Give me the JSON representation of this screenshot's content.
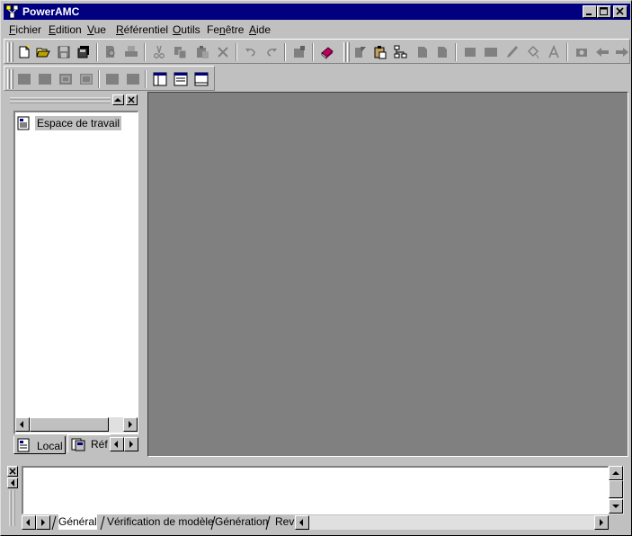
{
  "window": {
    "title": "PowerAMC"
  },
  "menubar": {
    "items": [
      {
        "label_pre": "",
        "label_u": "F",
        "label_post": "ichier"
      },
      {
        "label_pre": "",
        "label_u": "E",
        "label_post": "dition"
      },
      {
        "label_pre": "",
        "label_u": "V",
        "label_post": "ue"
      },
      {
        "label_pre": "",
        "label_u": "R",
        "label_post": "éférentiel"
      },
      {
        "label_pre": "",
        "label_u": "O",
        "label_post": "utils"
      },
      {
        "label_pre": "Fe",
        "label_u": "n",
        "label_post": "être"
      },
      {
        "label_pre": "",
        "label_u": "A",
        "label_post": "ide"
      }
    ]
  },
  "browser": {
    "root_item": "Espace de travail",
    "tabs": {
      "local": "Local",
      "repository": "Réf"
    }
  },
  "output": {
    "tabs": [
      "Général",
      "Vérification de modèle",
      "Génération",
      "Rev"
    ]
  },
  "icons": {
    "new": "new-document-icon",
    "open": "open-folder-icon",
    "save": "save-icon",
    "save_all": "save-all-icon",
    "print_preview": "print-preview-icon",
    "print": "print-icon",
    "cut": "cut-icon",
    "copy": "copy-icon",
    "paste": "paste-icon",
    "delete": "delete-icon",
    "undo": "undo-icon",
    "redo": "redo-icon",
    "properties": "properties-icon",
    "help": "help-book-icon"
  }
}
